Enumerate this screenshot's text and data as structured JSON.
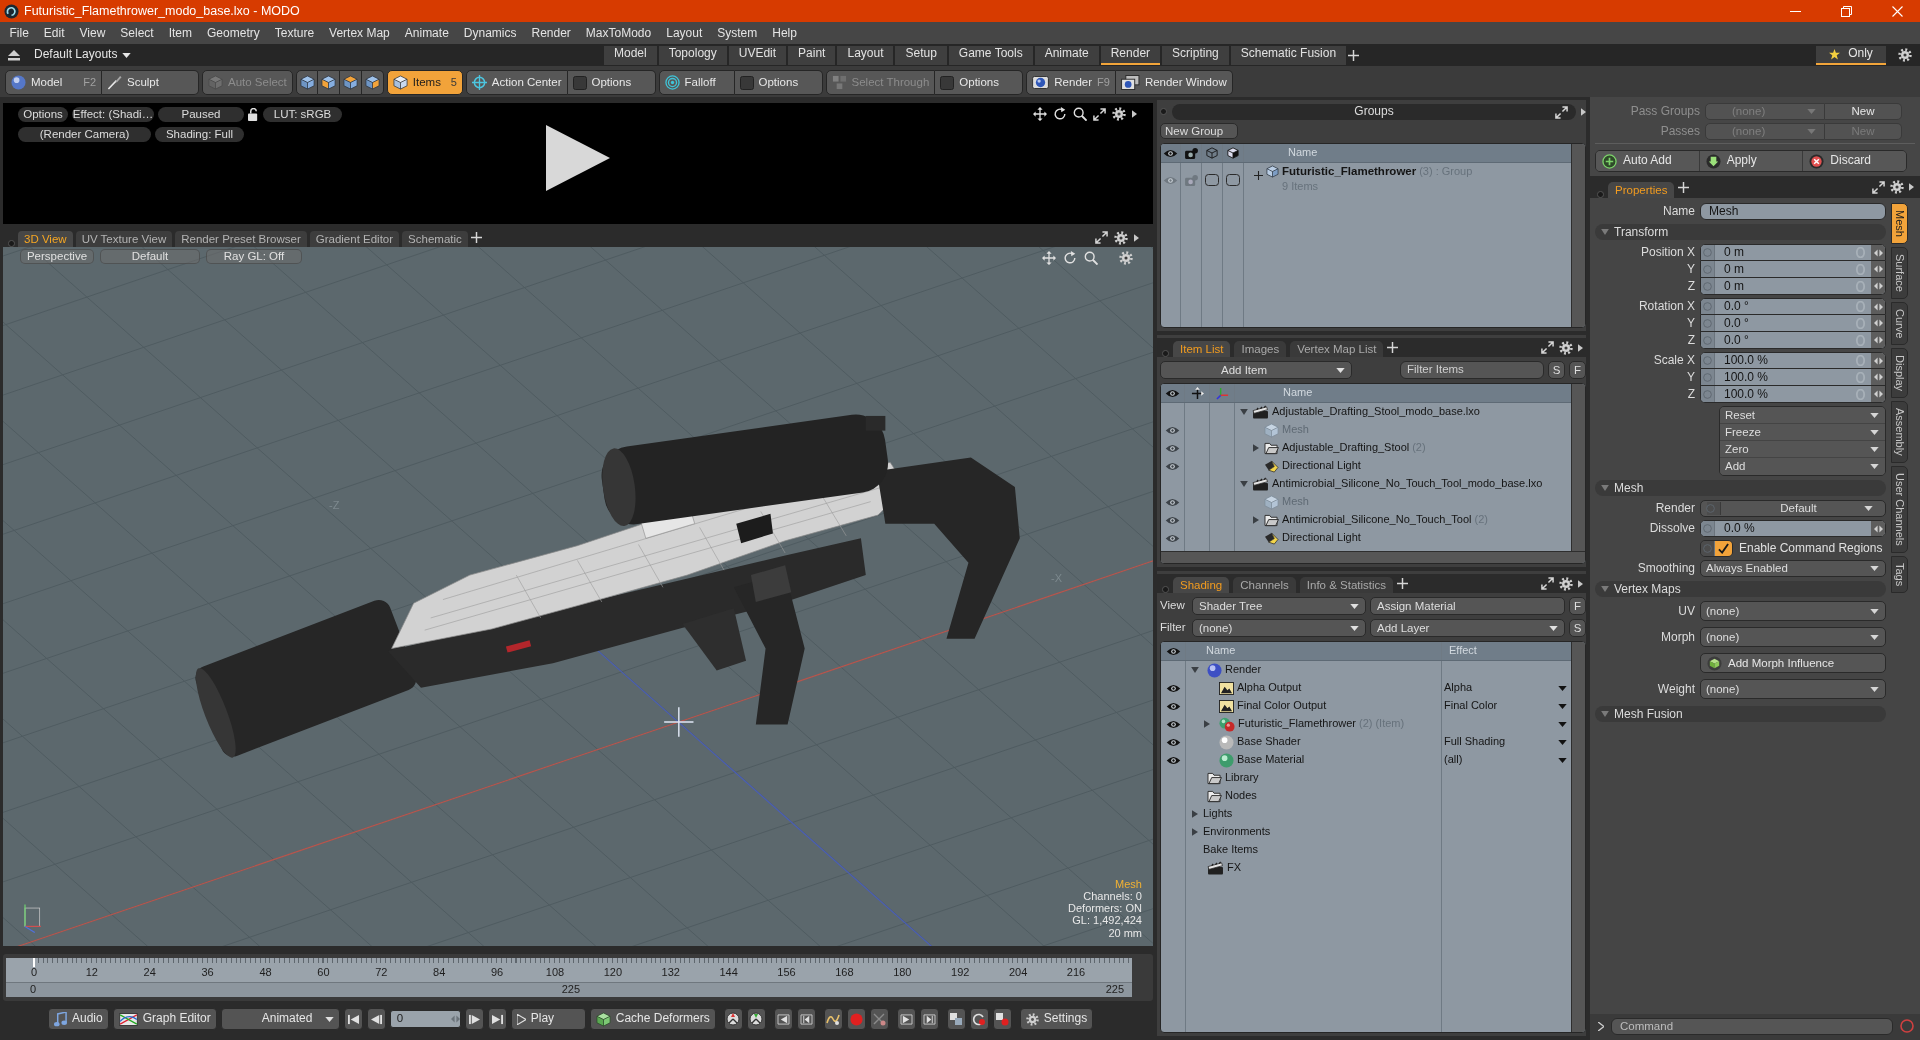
{
  "window": {
    "title": "Futuristic_Flamethrower_modo_base.lxo - MODO"
  },
  "menu": [
    "File",
    "Edit",
    "View",
    "Select",
    "Item",
    "Geometry",
    "Texture",
    "Vertex Map",
    "Animate",
    "Dynamics",
    "Render",
    "MaxToModo",
    "Layout",
    "System",
    "Help"
  ],
  "layouts": {
    "dropdown": "Default Layouts",
    "tabs": [
      {
        "label": "Model",
        "selected": false
      },
      {
        "label": "Topology",
        "selected": false
      },
      {
        "label": "UVEdit",
        "selected": false
      },
      {
        "label": "Paint",
        "selected": false
      },
      {
        "label": "Layout",
        "selected": false
      },
      {
        "label": "Setup",
        "selected": false
      },
      {
        "label": "Game Tools",
        "selected": false
      },
      {
        "label": "Animate",
        "selected": false
      },
      {
        "label": "Render",
        "selected": true
      },
      {
        "label": "Scripting",
        "selected": false
      },
      {
        "label": "Schematic Fusion",
        "selected": false
      }
    ],
    "only": {
      "label": "Only",
      "selected": true
    }
  },
  "toolbar": [
    [
      {
        "kind": "model",
        "label": "Model",
        "hotkey": "F2",
        "selected": false,
        "disabled": false
      },
      {
        "kind": "sculpt",
        "label": "Sculpt",
        "selected": false,
        "disabled": false
      }
    ],
    [
      {
        "kind": "auto-select",
        "label": "Auto Select",
        "selected": false,
        "disabled": true
      }
    ],
    [
      {
        "kind": "vertices",
        "selected": false,
        "disabled": false
      },
      {
        "kind": "edges",
        "selected": false,
        "disabled": false
      },
      {
        "kind": "polygons",
        "selected": false,
        "disabled": false
      },
      {
        "kind": "materials",
        "selected": false,
        "disabled": false
      }
    ],
    [
      {
        "kind": "items",
        "label": "Items",
        "hotkey": "5",
        "selected": true,
        "disabled": false
      }
    ],
    [
      {
        "kind": "action-center",
        "label": "Action Center",
        "selected": false,
        "disabled": false
      },
      {
        "kind": "options",
        "label": "Options",
        "checked": false,
        "selected": false,
        "disabled": false
      }
    ],
    [
      {
        "kind": "falloff",
        "label": "Falloff",
        "selected": false,
        "disabled": false
      },
      {
        "kind": "options",
        "label": "Options",
        "checked": false,
        "selected": false,
        "disabled": false
      }
    ],
    [
      {
        "kind": "select-through",
        "label": "Select Through",
        "selected": false,
        "disabled": true
      },
      {
        "kind": "options",
        "label": "Options",
        "checked": false,
        "selected": false,
        "disabled": false
      }
    ],
    [
      {
        "kind": "render",
        "label": "Render",
        "hotkey": "F9",
        "selected": false,
        "disabled": false
      },
      {
        "kind": "render-window",
        "label": "Render Window",
        "selected": false,
        "disabled": false
      }
    ]
  ],
  "render_preview": {
    "row1": [
      "Options",
      "Effect: (Shadi…",
      "Paused"
    ],
    "lut": "LUT: sRGB",
    "row2": [
      "(Render Camera)",
      "Shading: Full"
    ]
  },
  "viewport_tabs": [
    {
      "label": "3D View",
      "selected": true
    },
    {
      "label": "UV Texture View",
      "selected": false
    },
    {
      "label": "Render Preset Browser",
      "selected": false
    },
    {
      "label": "Gradient Editor",
      "selected": false
    },
    {
      "label": "Schematic",
      "selected": false
    }
  ],
  "viewport": {
    "buttons": [
      "Perspective",
      "Default",
      "Ray GL: Off"
    ],
    "axis_labels": [
      "-Z",
      "-X"
    ],
    "info_title": "Mesh",
    "info_lines": [
      "Channels: 0",
      "Deformers: ON",
      "GL: 1,492,424",
      "20 mm"
    ]
  },
  "timeline": {
    "ticks": [
      "0",
      "12",
      "24",
      "36",
      "48",
      "60",
      "72",
      "84",
      "96",
      "108",
      "120",
      "132",
      "144",
      "156",
      "168",
      "180",
      "192",
      "204",
      "216"
    ],
    "range": [
      "0",
      "225",
      "225"
    ]
  },
  "transport": {
    "audio": "Audio",
    "graph_editor": "Graph Editor",
    "mode": "Animated",
    "frame": "0",
    "play": "Play",
    "cache": "Cache Deformers",
    "settings": "Settings"
  },
  "groups": {
    "title": "Groups",
    "new_group": "New Group",
    "column": "Name",
    "rows": [
      {
        "name": "Futuristic_Flamethrower",
        "count": "(3)",
        "type": ": Group",
        "detail": "9 Items",
        "expanded": false
      }
    ]
  },
  "item_list": {
    "tabs": [
      {
        "label": "Item List",
        "selected": true
      },
      {
        "label": "Images",
        "selected": false
      },
      {
        "label": "Vertex Map List",
        "selected": false
      }
    ],
    "add_item": "Add Item",
    "filter": {
      "placeholder": "Filter Items"
    },
    "buttons": [
      "S",
      "F"
    ],
    "column": "Name",
    "tree": [
      {
        "name": "Adjustable_Drafting_Stool_modo_base.lxo",
        "kind": "scene",
        "expanded": true,
        "visible": false,
        "dimmed": false,
        "children": [
          {
            "name": "Mesh",
            "kind": "mesh",
            "visible": true,
            "dimmed": true
          },
          {
            "name": "Adjustable_Drafting_Stool",
            "count": "(2)",
            "kind": "locator",
            "expanded": false,
            "visible": true,
            "dimmed": false
          },
          {
            "name": "Directional Light",
            "kind": "light",
            "visible": true,
            "dimmed": false
          }
        ]
      },
      {
        "name": "Antimicrobial_Silicone_No_Touch_Tool_modo_base.lxo",
        "kind": "scene",
        "expanded": true,
        "visible": false,
        "dimmed": false,
        "children": [
          {
            "name": "Mesh",
            "kind": "mesh",
            "visible": true,
            "dimmed": true
          },
          {
            "name": "Antimicrobial_Silicone_No_Touch_Tool",
            "count": "(2)",
            "kind": "locator",
            "expanded": false,
            "visible": true,
            "dimmed": false
          },
          {
            "name": "Directional Light",
            "kind": "light",
            "visible": true,
            "dimmed": false
          }
        ]
      }
    ]
  },
  "shading": {
    "tabs": [
      {
        "label": "Shading",
        "selected": true
      },
      {
        "label": "Channels",
        "selected": false
      },
      {
        "label": "Info & Statistics",
        "selected": false
      }
    ],
    "view": {
      "label": "View",
      "value": "Shader Tree"
    },
    "assign": "Assign Material",
    "filter": {
      "label": "Filter",
      "value": "(none)"
    },
    "add_layer": "Add Layer",
    "buttons": [
      "F",
      "S"
    ],
    "columns": [
      "Name",
      "Effect"
    ],
    "tree": [
      {
        "name": "Render",
        "kind": "render",
        "expanded": true,
        "visible": false,
        "children": [
          {
            "name": "Alpha Output",
            "kind": "output",
            "effect": "Alpha",
            "visible": true
          },
          {
            "name": "Final Color Output",
            "kind": "output",
            "effect": "Final Color",
            "visible": true
          },
          {
            "name": "Futuristic_Flamethrower",
            "count": "(2)",
            "note": "(Item)",
            "kind": "material-group",
            "expanded": false,
            "visible": true
          },
          {
            "name": "Base Shader",
            "kind": "shader",
            "effect": "Full Shading",
            "visible": true
          },
          {
            "name": "Base Material",
            "kind": "material",
            "effect": "(all)",
            "visible": true
          }
        ]
      },
      {
        "name": "Library",
        "kind": "folder",
        "visible": false
      },
      {
        "name": "Nodes",
        "kind": "folder",
        "visible": false
      },
      {
        "name": "Lights",
        "kind": "group",
        "expanded": false,
        "visible": false
      },
      {
        "name": "Environments",
        "kind": "group",
        "expanded": false,
        "visible": false
      },
      {
        "name": "Bake Items",
        "kind": "group",
        "visible": false
      },
      {
        "name": "FX",
        "kind": "fx",
        "visible": false
      }
    ]
  },
  "properties": {
    "passes": [
      {
        "label": "Pass Groups",
        "value": "(none)",
        "button": "New",
        "disabled": false
      },
      {
        "label": "Passes",
        "value": "(none)",
        "button": "New",
        "disabled": true
      }
    ],
    "actions": [
      {
        "kind": "add",
        "label": "Auto Add"
      },
      {
        "kind": "apply",
        "label": "Apply"
      },
      {
        "kind": "discard",
        "label": "Discard"
      }
    ],
    "tabs": [
      {
        "label": "Properties",
        "selected": true
      }
    ],
    "name": {
      "label": "Name",
      "value": "Mesh"
    },
    "sections": [
      {
        "title": "Transform",
        "fields": [
          {
            "kind": "vector",
            "rows": [
              {
                "label": "Position X",
                "value": "0 m"
              },
              {
                "label": "Y",
                "value": "0 m"
              },
              {
                "label": "Z",
                "value": "0 m"
              }
            ]
          },
          {
            "kind": "vector",
            "rows": [
              {
                "label": "Rotation X",
                "value": "0.0 °"
              },
              {
                "label": "Y",
                "value": "0.0 °"
              },
              {
                "label": "Z",
                "value": "0.0 °"
              }
            ]
          },
          {
            "kind": "vector",
            "rows": [
              {
                "label": "Scale X",
                "value": "100.0 %"
              },
              {
                "label": "Y",
                "value": "100.0 %"
              },
              {
                "label": "Z",
                "value": "100.0 %"
              }
            ]
          },
          {
            "kind": "menus",
            "items": [
              "Reset",
              "Freeze",
              "Zero",
              "Add"
            ]
          }
        ]
      },
      {
        "title": "Mesh",
        "fields": [
          {
            "kind": "channel-select",
            "label": "Render",
            "value": "Default"
          },
          {
            "kind": "number",
            "label": "Dissolve",
            "value": "0.0 %"
          },
          {
            "kind": "checkbox",
            "label": "Enable Command Regions",
            "checked": true
          },
          {
            "kind": "select",
            "label": "Smoothing",
            "value": "Always Enabled"
          }
        ]
      },
      {
        "title": "Vertex Maps",
        "fields": [
          {
            "kind": "select",
            "label": "UV",
            "value": "(none)"
          },
          {
            "kind": "select",
            "label": "Morph",
            "value": "(none)"
          },
          {
            "kind": "button",
            "label": "Add Morph Influence"
          },
          {
            "kind": "select",
            "label": "Weight",
            "value": "(none)"
          }
        ]
      },
      {
        "title": "Mesh Fusion"
      }
    ],
    "side_tabs": [
      {
        "label": "Mesh",
        "selected": true
      },
      {
        "label": "Surface",
        "selected": false
      },
      {
        "label": "Curve",
        "selected": false
      },
      {
        "label": "Display",
        "selected": false
      },
      {
        "label": "Assembly",
        "selected": false
      },
      {
        "label": "User Channels",
        "selected": false
      },
      {
        "label": "Tags",
        "selected": false
      }
    ]
  },
  "command": {
    "placeholder": "Command"
  }
}
